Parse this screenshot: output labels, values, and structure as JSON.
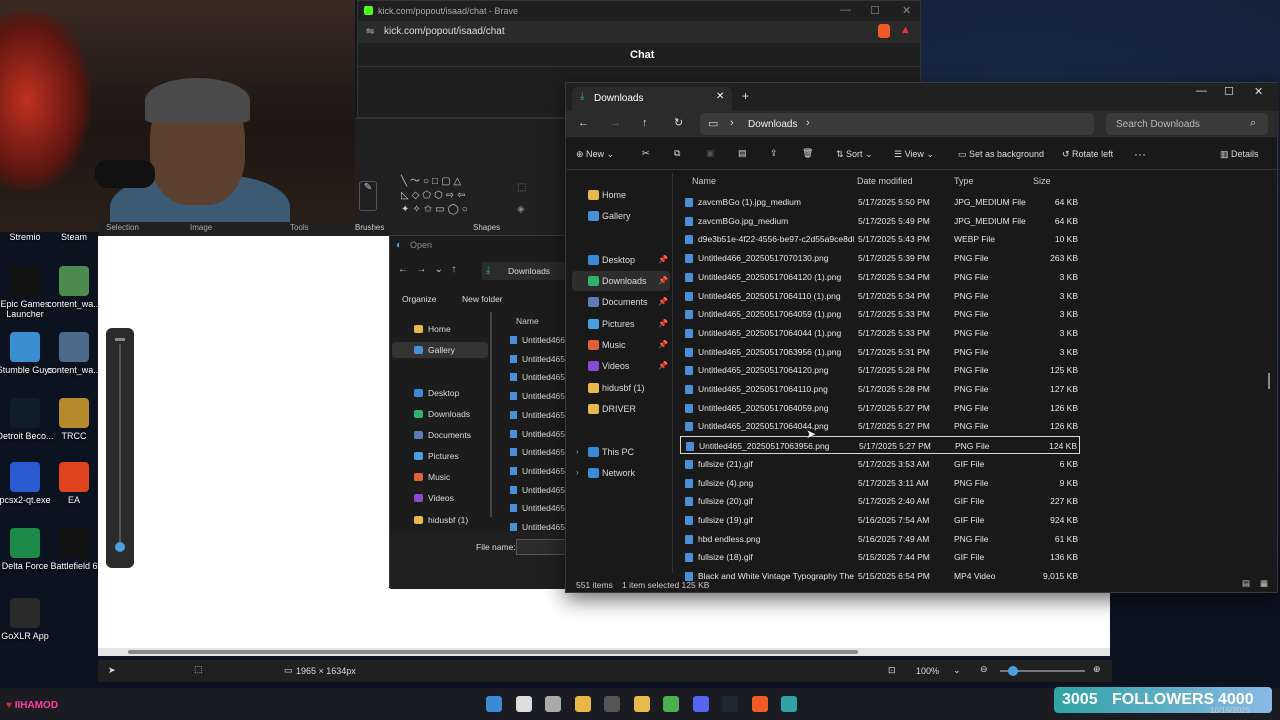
{
  "brave": {
    "title": "kick.com/popout/isaad/chat - Brave",
    "url": "kick.com/popout/isaad/chat",
    "chat_heading": "Chat"
  },
  "desktop_icons": [
    {
      "label": "Stremio",
      "color": "#6b3fa0"
    },
    {
      "label": "Steam",
      "color": "#1b2838"
    },
    {
      "label": "Epic Games Launcher",
      "color": "#111111"
    },
    {
      "label": "content_wa...",
      "color": "#4d8a4d"
    },
    {
      "label": "Stumble Guys",
      "color": "#3a8fd0"
    },
    {
      "label": "content_wa...",
      "color": "#4d6a8a"
    },
    {
      "label": "Detroit Beco...",
      "color": "#0f1c2a"
    },
    {
      "label": "TRCC",
      "color": "#b58a2a"
    },
    {
      "label": "pcsx2-qt.exe",
      "color": "#2a5bd0"
    },
    {
      "label": "EA",
      "color": "#e0441f"
    },
    {
      "label": "Delta Force",
      "color": "#1d8a4a"
    },
    {
      "label": "Battlefield 6",
      "color": "#111111"
    },
    {
      "label": "GoXLR App",
      "color": "#2a2a2a"
    }
  ],
  "paint": {
    "groups": [
      "Selection",
      "Image",
      "Tools",
      "Brushes",
      "Shapes"
    ],
    "dimensions": "1965 × 1634px",
    "zoom": "100%"
  },
  "open_dialog": {
    "title": "Open",
    "path": "Downloads",
    "organize": "Organize",
    "new_folder": "New folder",
    "name_col": "Name",
    "nav": [
      "Home",
      "Gallery",
      "Desktop",
      "Downloads",
      "Documents",
      "Pictures",
      "Music",
      "Videos",
      "hidusbf (1)"
    ],
    "files": [
      "Untitled466_",
      "Untitled465_",
      "Untitled465_",
      "Untitled465_",
      "Untitled465_",
      "Untitled465_",
      "Untitled465_",
      "Untitled465_",
      "Untitled465_",
      "Untitled465_",
      "Untitled465_"
    ],
    "file_name_label": "File name:"
  },
  "explorer": {
    "tab_title": "Downloads",
    "breadcrumb": "Downloads",
    "search_placeholder": "Search Downloads",
    "commands": {
      "new": "New",
      "sort": "Sort",
      "view": "View",
      "set_bg": "Set as background",
      "rotate": "Rotate left",
      "details": "Details"
    },
    "nav": [
      {
        "label": "Home",
        "color": "#e8b84a"
      },
      {
        "label": "Gallery",
        "color": "#4a90d9"
      },
      {
        "label": "Desktop",
        "color": "#3a8ad8"
      },
      {
        "label": "Downloads",
        "color": "#2fb36a"
      },
      {
        "label": "Documents",
        "color": "#5a7fb8"
      },
      {
        "label": "Pictures",
        "color": "#4aa0e0"
      },
      {
        "label": "Music",
        "color": "#e0603a"
      },
      {
        "label": "Videos",
        "color": "#8a4ad0"
      },
      {
        "label": "hidusbf (1)",
        "color": "#e8b84a"
      },
      {
        "label": "DRIVER",
        "color": "#e8b84a"
      },
      {
        "label": "This PC",
        "color": "#3a8ad8"
      },
      {
        "label": "Network",
        "color": "#3a8ad8"
      }
    ],
    "columns": {
      "name": "Name",
      "date": "Date modified",
      "type": "Type",
      "size": "Size"
    },
    "files": [
      {
        "name": "zavcmBGo (1).jpg_medium",
        "date": "5/17/2025 5:50 PM",
        "type": "JPG_MEDIUM File",
        "size": "64 KB"
      },
      {
        "name": "zavcmBGo.jpg_medium",
        "date": "5/17/2025 5:49 PM",
        "type": "JPG_MEDIUM File",
        "size": "64 KB"
      },
      {
        "name": "d9e3b51e-4f22-4556-be97-c2d55a9ce8d8...",
        "date": "5/17/2025 5:43 PM",
        "type": "WEBP File",
        "size": "10 KB"
      },
      {
        "name": "Untitled466_20250517070130.png",
        "date": "5/17/2025 5:39 PM",
        "type": "PNG File",
        "size": "263 KB"
      },
      {
        "name": "Untitled465_20250517064120 (1).png",
        "date": "5/17/2025 5:34 PM",
        "type": "PNG File",
        "size": "3 KB"
      },
      {
        "name": "Untitled465_20250517064110 (1).png",
        "date": "5/17/2025 5:34 PM",
        "type": "PNG File",
        "size": "3 KB"
      },
      {
        "name": "Untitled465_20250517064059 (1).png",
        "date": "5/17/2025 5:33 PM",
        "type": "PNG File",
        "size": "3 KB"
      },
      {
        "name": "Untitled465_20250517064044 (1).png",
        "date": "5/17/2025 5:33 PM",
        "type": "PNG File",
        "size": "3 KB"
      },
      {
        "name": "Untitled465_20250517063956 (1).png",
        "date": "5/17/2025 5:31 PM",
        "type": "PNG File",
        "size": "3 KB"
      },
      {
        "name": "Untitled465_20250517064120.png",
        "date": "5/17/2025 5:28 PM",
        "type": "PNG File",
        "size": "125 KB"
      },
      {
        "name": "Untitled465_20250517064110.png",
        "date": "5/17/2025 5:28 PM",
        "type": "PNG File",
        "size": "127 KB"
      },
      {
        "name": "Untitled465_20250517064059.png",
        "date": "5/17/2025 5:27 PM",
        "type": "PNG File",
        "size": "126 KB"
      },
      {
        "name": "Untitled465_20250517064044.png",
        "date": "5/17/2025 5:27 PM",
        "type": "PNG File",
        "size": "126 KB"
      },
      {
        "name": "Untitled465_20250517063956.png",
        "date": "5/17/2025 5:27 PM",
        "type": "PNG File",
        "size": "124 KB"
      },
      {
        "name": "fullsize (21).gif",
        "date": "5/17/2025 3:53 AM",
        "type": "GIF File",
        "size": "6 KB"
      },
      {
        "name": "fullsize (4).png",
        "date": "5/17/2025 3:11 AM",
        "type": "PNG File",
        "size": "9 KB"
      },
      {
        "name": "fullsize (20).gif",
        "date": "5/17/2025 2:40 AM",
        "type": "GIF File",
        "size": "227 KB"
      },
      {
        "name": "fullsize (19).gif",
        "date": "5/16/2025 7:54 AM",
        "type": "GIF File",
        "size": "924 KB"
      },
      {
        "name": "hbd endless.png",
        "date": "5/16/2025 7:49 AM",
        "type": "PNG File",
        "size": "61 KB"
      },
      {
        "name": "fullsize (18).gif",
        "date": "5/15/2025 7:44 PM",
        "type": "GIF File",
        "size": "136 KB"
      },
      {
        "name": "Black and White Vintage Typography The...",
        "date": "5/15/2025 6:54 PM",
        "type": "MP4 Video",
        "size": "9,015 KB"
      }
    ],
    "selected_index": 13,
    "status_items": "551 items",
    "status_selected": "1 item selected  125 KB"
  },
  "overlay": {
    "followers_count": "3005",
    "followers_label": "FOLLOWERS",
    "goal": "4000",
    "date": "10/15/2025",
    "user": "IIHAMOD"
  }
}
